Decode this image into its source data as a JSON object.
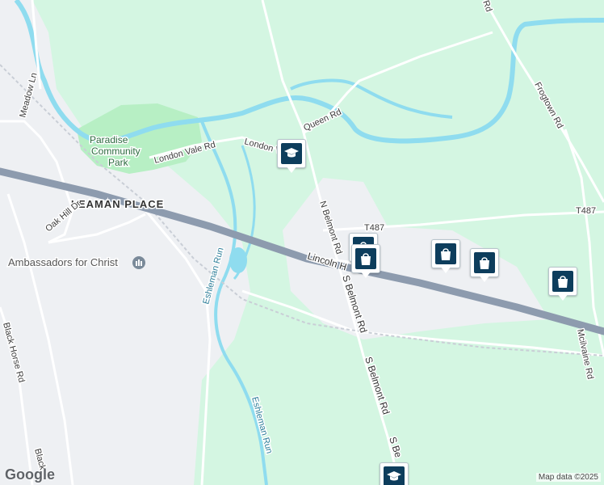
{
  "map": {
    "colors": {
      "land": "#d4f6e2",
      "urban": "#eef0f3",
      "park": "#b7efc4",
      "water": "#8fdcef",
      "road": "#ffffff",
      "road_outline": "#c9ced6",
      "highway": "#8d9bae",
      "marker_glyph": "#0d3d5c"
    },
    "labels": {
      "place": "LEAMAN PLACE",
      "park_line1": "Paradise",
      "park_line2": "Community",
      "park_line3": "Park",
      "poi": "Ambassadors for Christ",
      "meadow_ln": "Meadow Ln",
      "oak_hill_dr": "Oak Hill Dr",
      "london_vale_rd": "London Vale Rd",
      "london_v": "London V",
      "queen_rd": "Queen Rd",
      "n_belmont_rd": "N Belmont Rd",
      "lincoln_h": "Lincoln H",
      "s_belmont_rd_1": "S Belmont Rd",
      "s_belmont_rd_2": "S Belmont Rd",
      "s_be": "S Be",
      "t487_1": "T487",
      "t487_2": "T487",
      "frogtown_rd": "Frogtown Rd",
      "mcilvaine_rd": "Mcilvaine Rd",
      "eshleman_run_1": "Eshleman Run",
      "eshleman_run_2": "Eshleman Run",
      "black_horse_rd_1": "Black Horse Rd",
      "black_horse_rd_2": "Black",
      "top_rd": "Rd"
    },
    "markers": [
      {
        "type": "school",
        "icon": "graduation-cap-icon"
      },
      {
        "type": "shopping",
        "icon": "shopping-bag-icon"
      },
      {
        "type": "shopping",
        "icon": "shopping-bag-icon"
      },
      {
        "type": "shopping",
        "icon": "shopping-bag-icon"
      },
      {
        "type": "shopping",
        "icon": "shopping-bag-icon"
      },
      {
        "type": "shopping",
        "icon": "shopping-bag-icon"
      },
      {
        "type": "school",
        "icon": "graduation-cap-icon"
      }
    ],
    "logo": "Google",
    "attribution": "Map data ©2025"
  }
}
